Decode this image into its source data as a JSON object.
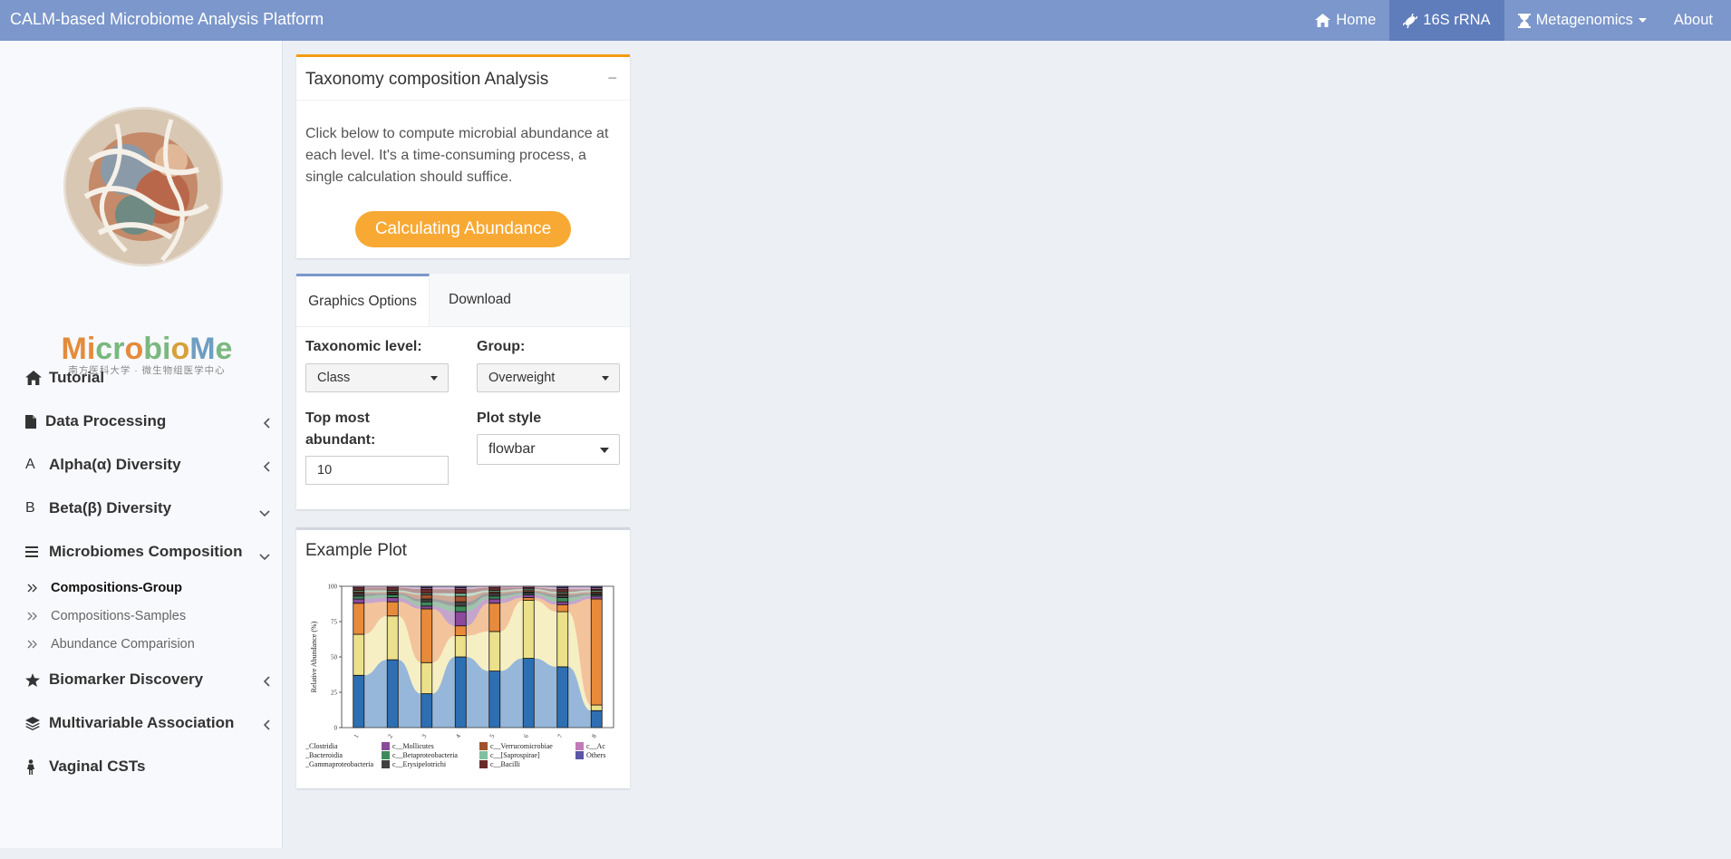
{
  "navbar": {
    "brand": "CALM-based Microbiome Analysis Platform",
    "items": [
      {
        "label": "Home",
        "icon": "home-icon"
      },
      {
        "label": "16S rRNA",
        "icon": "bacterium-icon",
        "active": true
      },
      {
        "label": "Metagenomics",
        "icon": "hourglass-icon",
        "dropdown": true
      },
      {
        "label": "About"
      }
    ]
  },
  "sidebar": {
    "logo": {
      "word": "Microbiome",
      "subtitle": "南方医科大学 · 微生物组医学中心"
    },
    "menu": [
      {
        "label": "Tutorial",
        "icon": "home-icon"
      },
      {
        "label": "Data Processing",
        "icon": "file-icon",
        "chevron": "left"
      },
      {
        "label": "Alpha(α) Diversity",
        "icon": "alpha-icon",
        "chevron": "left"
      },
      {
        "label": "Beta(β) Diversity",
        "icon": "beta-icon",
        "chevron": "down"
      },
      {
        "label": "Microbiomes Composition",
        "icon": "bars-icon",
        "chevron": "down"
      },
      {
        "label": "Biomarker Discovery",
        "icon": "star-icon",
        "chevron": "left"
      },
      {
        "label": "Multivariable Association",
        "icon": "layers-icon",
        "chevron": "left"
      },
      {
        "label": "Vaginal CSTs",
        "icon": "female-icon"
      }
    ],
    "submenu": [
      {
        "label": "Compositions-Group",
        "active": true
      },
      {
        "label": "Compositions-Samples"
      },
      {
        "label": "Abundance Comparision"
      }
    ]
  },
  "taxonomy_box": {
    "title": "Taxonomy composition Analysis",
    "collapse": "−",
    "description": "Click below to compute microbial abundance at each level. It's a time-consuming process, a single calculation should suffice.",
    "button": "Calculating Abundance"
  },
  "options_box": {
    "tabs": [
      "Graphics Options",
      "Download"
    ],
    "taxonomic_level_label": "Taxonomic level:",
    "taxonomic_level_value": "Class",
    "group_label": "Group:",
    "group_value": "Overweight",
    "top_label": "Top most abundant:",
    "top_value": "10",
    "plot_style_label": "Plot style",
    "plot_style_value": "flowbar"
  },
  "example_box": {
    "title": "Example Plot"
  },
  "chart_data": {
    "type": "bar",
    "ylabel": "Relative Abundance (%)",
    "ylim": [
      0,
      100
    ],
    "yticks": [
      "0",
      "25",
      "50",
      "75",
      "100"
    ],
    "categories": [
      "1",
      "2",
      "3",
      "4",
      "5",
      "6",
      "7",
      "8"
    ],
    "series": [
      {
        "name": "c__Clostridia",
        "color": "#2e6fb3",
        "values": [
          37,
          48,
          24,
          50,
          40,
          49,
          43,
          12
        ]
      },
      {
        "name": "c__Bacteroidia",
        "color": "#ede08a",
        "values": [
          29,
          31,
          22,
          15,
          28,
          41,
          39,
          4
        ]
      },
      {
        "name": "c__Gammaproteobacteria",
        "color": "#e88a3a",
        "values": [
          22,
          10,
          38,
          7,
          20,
          2,
          5,
          75
        ]
      },
      {
        "name": "c__Mollicutes",
        "color": "#8b4a9b",
        "values": [
          3,
          3,
          2,
          10,
          3,
          2,
          2,
          2
        ]
      },
      {
        "name": "c__Betaproteobacteria",
        "color": "#3f8a5a",
        "values": [
          2,
          2,
          3,
          4,
          2,
          1,
          3,
          1
        ]
      },
      {
        "name": "c__Erysipelotrichi",
        "color": "#404040",
        "values": [
          2,
          1,
          2,
          3,
          2,
          1,
          2,
          1
        ]
      },
      {
        "name": "c__Verrucomicrobiae",
        "color": "#a0522d",
        "values": [
          1,
          1,
          3,
          4,
          1,
          1,
          1,
          1
        ]
      },
      {
        "name": "c__[Saprospirae]",
        "color": "#7fbf9f",
        "values": [
          1,
          1,
          1,
          2,
          1,
          1,
          1,
          1
        ]
      },
      {
        "name": "c__Bacilli",
        "color": "#6b2a2a",
        "values": [
          2,
          2,
          3,
          3,
          2,
          1,
          2,
          1
        ]
      },
      {
        "name": "c__Ac",
        "color": "#c07ab8",
        "values": [
          1,
          1,
          1,
          1,
          1,
          1,
          1,
          1
        ]
      },
      {
        "name": "Others",
        "color": "#5a55a8",
        "values": [
          0,
          0,
          1,
          1,
          0,
          0,
          1,
          1
        ]
      }
    ]
  }
}
